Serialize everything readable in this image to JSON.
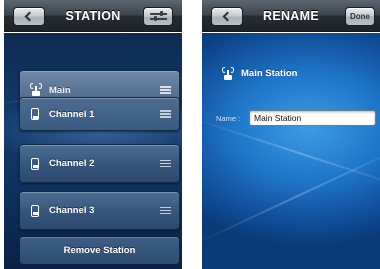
{
  "station_screen": {
    "title": "STATION",
    "rows": [
      {
        "label": "Main",
        "icon": "station-icon"
      },
      {
        "label": "Channel 1",
        "icon": "phone-icon"
      },
      {
        "label": "Channel 2",
        "icon": "phone-icon"
      },
      {
        "label": "Channel 3",
        "icon": "phone-icon"
      }
    ],
    "remove_label": "Remove Station"
  },
  "rename_screen": {
    "title": "RENAME",
    "done_label": "Done",
    "station_name": "Main Station",
    "name_label": "Name :",
    "name_value": "Main Station"
  },
  "colors": {
    "nav_bar": "#262c32",
    "list_background": "#123a6c",
    "rename_background": "#1f75c8",
    "text": "#ffffff"
  }
}
